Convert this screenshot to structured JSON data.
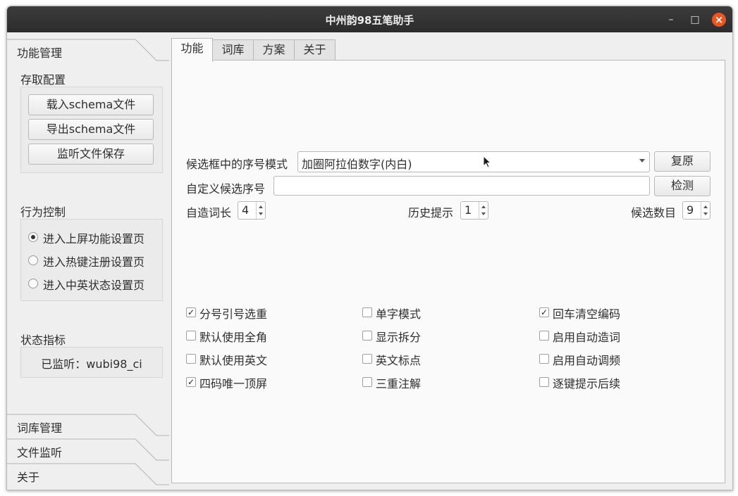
{
  "window": {
    "title": "中州韵98五笔助手"
  },
  "toolbox": {
    "pages": [
      {
        "label": "功能管理"
      },
      {
        "label": "词库管理"
      },
      {
        "label": "文件监听"
      },
      {
        "label": "关于"
      }
    ],
    "config_group": {
      "title": "存取配置",
      "buttons": [
        "载入schema文件",
        "导出schema文件",
        "监听文件保存"
      ]
    },
    "behavior_group": {
      "title": "行为控制",
      "options": [
        "进入上屏功能设置页",
        "进入热键注册设置页",
        "进入中英状态设置页"
      ],
      "selected_index": 0
    },
    "status_group": {
      "title": "状态指标",
      "text": "已监听：wubi98_ci"
    }
  },
  "tabs": [
    "功能",
    "词库",
    "方案",
    "关于"
  ],
  "active_tab": 0,
  "function_page": {
    "index_mode": {
      "label": "候选框中的序号模式",
      "value": "加圈阿拉伯数字(内白)",
      "reset_label": "复原"
    },
    "custom_index": {
      "label": "自定义候选序号",
      "value": "",
      "detect_label": "检测"
    },
    "spinners": [
      {
        "label": "自造词长",
        "value": "4"
      },
      {
        "label": "历史提示",
        "value": "1"
      },
      {
        "label": "候选数目",
        "value": "9"
      }
    ],
    "checkboxes": [
      {
        "label": "分号引号选重",
        "checked": true
      },
      {
        "label": "单字模式",
        "checked": false
      },
      {
        "label": "回车清空编码",
        "checked": true
      },
      {
        "label": "默认使用全角",
        "checked": false
      },
      {
        "label": "显示拆分",
        "checked": false
      },
      {
        "label": "启用自动造词",
        "checked": false
      },
      {
        "label": "默认使用英文",
        "checked": false
      },
      {
        "label": "英文标点",
        "checked": false
      },
      {
        "label": "启用自动调频",
        "checked": false
      },
      {
        "label": "四码唯一顶屏",
        "checked": true
      },
      {
        "label": "三重注解",
        "checked": false
      },
      {
        "label": "逐键提示后续",
        "checked": false
      }
    ]
  },
  "colors": {
    "close_button": "#e95420",
    "titlebar": "#2c2c2c"
  }
}
